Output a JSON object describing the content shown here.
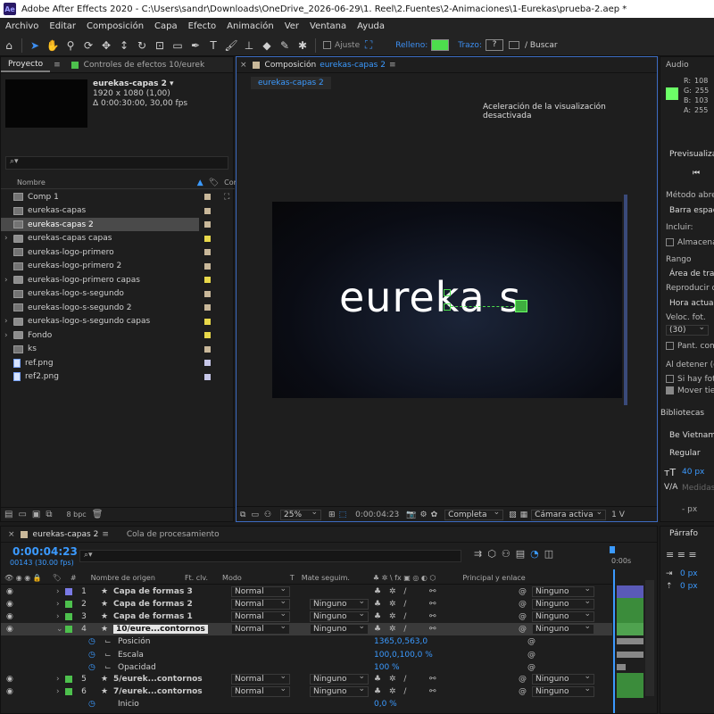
{
  "titlebar": {
    "app_logo": "Ae",
    "title": "Adobe After Effects 2020 - C:\\Users\\sandr\\Downloads\\OneDrive_2026-06-29\\1. Reel\\2.Fuentes\\2-Animaciones\\1-Eurekas\\prueba-2.aep *"
  },
  "menu": [
    "Archivo",
    "Editar",
    "Composición",
    "Capa",
    "Efecto",
    "Animación",
    "Ver",
    "Ventana",
    "Ayuda"
  ],
  "toolbar": {
    "ajuste": "Ajuste",
    "relleno": "Relleno:",
    "trazo": "Trazo:",
    "trazo_value": "?",
    "search": "/ Buscar",
    "fill_color": "#4dde4d"
  },
  "project": {
    "tab": "Proyecto",
    "effects_tab": "Controles de efectos 10/eurek",
    "selected_name": "eurekas-capas 2 ▾",
    "selected_res": "1920 x 1080 (1,00)",
    "selected_dur": "Δ 0:00:30:00, 30,00 fps",
    "search_icon": "⌕▾",
    "col_name": "Nombre",
    "col_com": "Com",
    "items": [
      {
        "name": "Comp 1",
        "type": "comp",
        "color": "#c9b89a"
      },
      {
        "name": "eurekas-capas",
        "type": "comp",
        "color": "#c9b89a"
      },
      {
        "name": "eurekas-capas 2",
        "type": "comp",
        "color": "#c9b89a",
        "selected": true
      },
      {
        "name": "eurekas-capas capas",
        "type": "folder",
        "color": "#e8d84a",
        "arrow": true
      },
      {
        "name": "eurekas-logo-primero",
        "type": "comp",
        "color": "#c9b89a"
      },
      {
        "name": "eurekas-logo-primero 2",
        "type": "comp",
        "color": "#c9b89a"
      },
      {
        "name": "eurekas-logo-primero capas",
        "type": "folder",
        "color": "#e8d84a",
        "arrow": true
      },
      {
        "name": "eurekas-logo-s-segundo",
        "type": "comp",
        "color": "#c9b89a"
      },
      {
        "name": "eurekas-logo-s-segundo 2",
        "type": "comp",
        "color": "#c9b89a"
      },
      {
        "name": "eurekas-logo-s-segundo capas",
        "type": "folder",
        "color": "#e8d84a",
        "arrow": true
      },
      {
        "name": "Fondo",
        "type": "folder",
        "color": "#e8d84a",
        "arrow": true
      },
      {
        "name": "ks",
        "type": "comp",
        "color": "#c9b89a"
      },
      {
        "name": "ref.png",
        "type": "png",
        "color": "#c7c7e8"
      },
      {
        "name": "ref2.png",
        "type": "png",
        "color": "#c7c7e8"
      }
    ],
    "bpc": "8 bpc"
  },
  "composition": {
    "tab_prefix": "Composición",
    "tab_name": "eurekas-capas 2",
    "subtab": "eurekas-capas 2",
    "accel_msg": "Aceleración de la visualización desactivada",
    "logo_text": "eureka s",
    "zoom": "25%",
    "timecode": "0:00:04:23",
    "quality": "Completa",
    "camera": "Cámara activa",
    "views": "1 V"
  },
  "right_panel": {
    "info_tab": "Audio",
    "rgba": [
      {
        "k": "R:",
        "v": "108"
      },
      {
        "k": "G:",
        "v": "255"
      },
      {
        "k": "B:",
        "v": "103"
      },
      {
        "k": "A:",
        "v": "255"
      }
    ],
    "swatch": "#6cff67",
    "preview": "Previsualizaci",
    "metodo": "Método abrevi",
    "barra": "Barra espaci",
    "incluir": "Incluir:",
    "almacenar": "Almacenar",
    "rango": "Rango",
    "area": "Área de trab",
    "reproducir": "Reproducir de",
    "hora": "Hora actual",
    "veloc": "Veloc. fot.",
    "veloc_value": "(30)",
    "pant": "Pant. comp",
    "al_detener": "Al detener (co",
    "si_hay": "Si hay foto",
    "mover": "Mover tie",
    "bibliotecas": "Bibliotecas",
    "font": "Be Vietnam",
    "style": "Regular",
    "size": "40 px",
    "tracking": "Medidas",
    "px_value": "- px",
    "parrafo": "Párrafo",
    "p0a": "0 px",
    "p0b": "0 px"
  },
  "timeline": {
    "tab": "eurekas-capas 2",
    "render_tab": "Cola de procesamiento",
    "timecode": "0:00:04:23",
    "frames": "00143 (30.00 fps)",
    "col_hash": "#",
    "col_name": "Nombre de origen",
    "col_ftclv": "Ft. clv.",
    "col_modo": "Modo",
    "col_t": "T",
    "col_mate": "Mate seguim.",
    "col_parent": "Principal y enlace",
    "ruler": "0:00s",
    "layers": [
      {
        "num": "1",
        "name": "Capa de formas 3",
        "mode": "Normal",
        "mate": "",
        "parent": "Ninguno",
        "color": "#7a7ae6"
      },
      {
        "num": "2",
        "name": "Capa de formas 2",
        "mode": "Normal",
        "mate": "Ninguno",
        "parent": "Ninguno",
        "color": "#4dc04d"
      },
      {
        "num": "3",
        "name": "Capa de formas 1",
        "mode": "Normal",
        "mate": "Ninguno",
        "parent": "Ninguno",
        "color": "#4dc04d"
      },
      {
        "num": "4",
        "name": "10/eure...contornos",
        "mode": "Normal",
        "mate": "Ninguno",
        "parent": "Ninguno",
        "color": "#4dc04d",
        "selected": true
      },
      {
        "num": "5",
        "name": "5/eurek...contornos",
        "mode": "Normal",
        "mate": "Ninguno",
        "parent": "Ninguno",
        "color": "#4dc04d"
      },
      {
        "num": "6",
        "name": "7/eurek...contornos",
        "mode": "Normal",
        "mate": "Ninguno",
        "parent": "Ninguno",
        "color": "#4dc04d"
      }
    ],
    "props": [
      {
        "name": "Posición",
        "value": "1365,0,563,0"
      },
      {
        "name": "Escala",
        "value": "100,0,100,0 %"
      },
      {
        "name": "Opacidad",
        "value": "100 %"
      }
    ],
    "inicio": {
      "name": "Inicio",
      "value": "0,0 %"
    }
  }
}
